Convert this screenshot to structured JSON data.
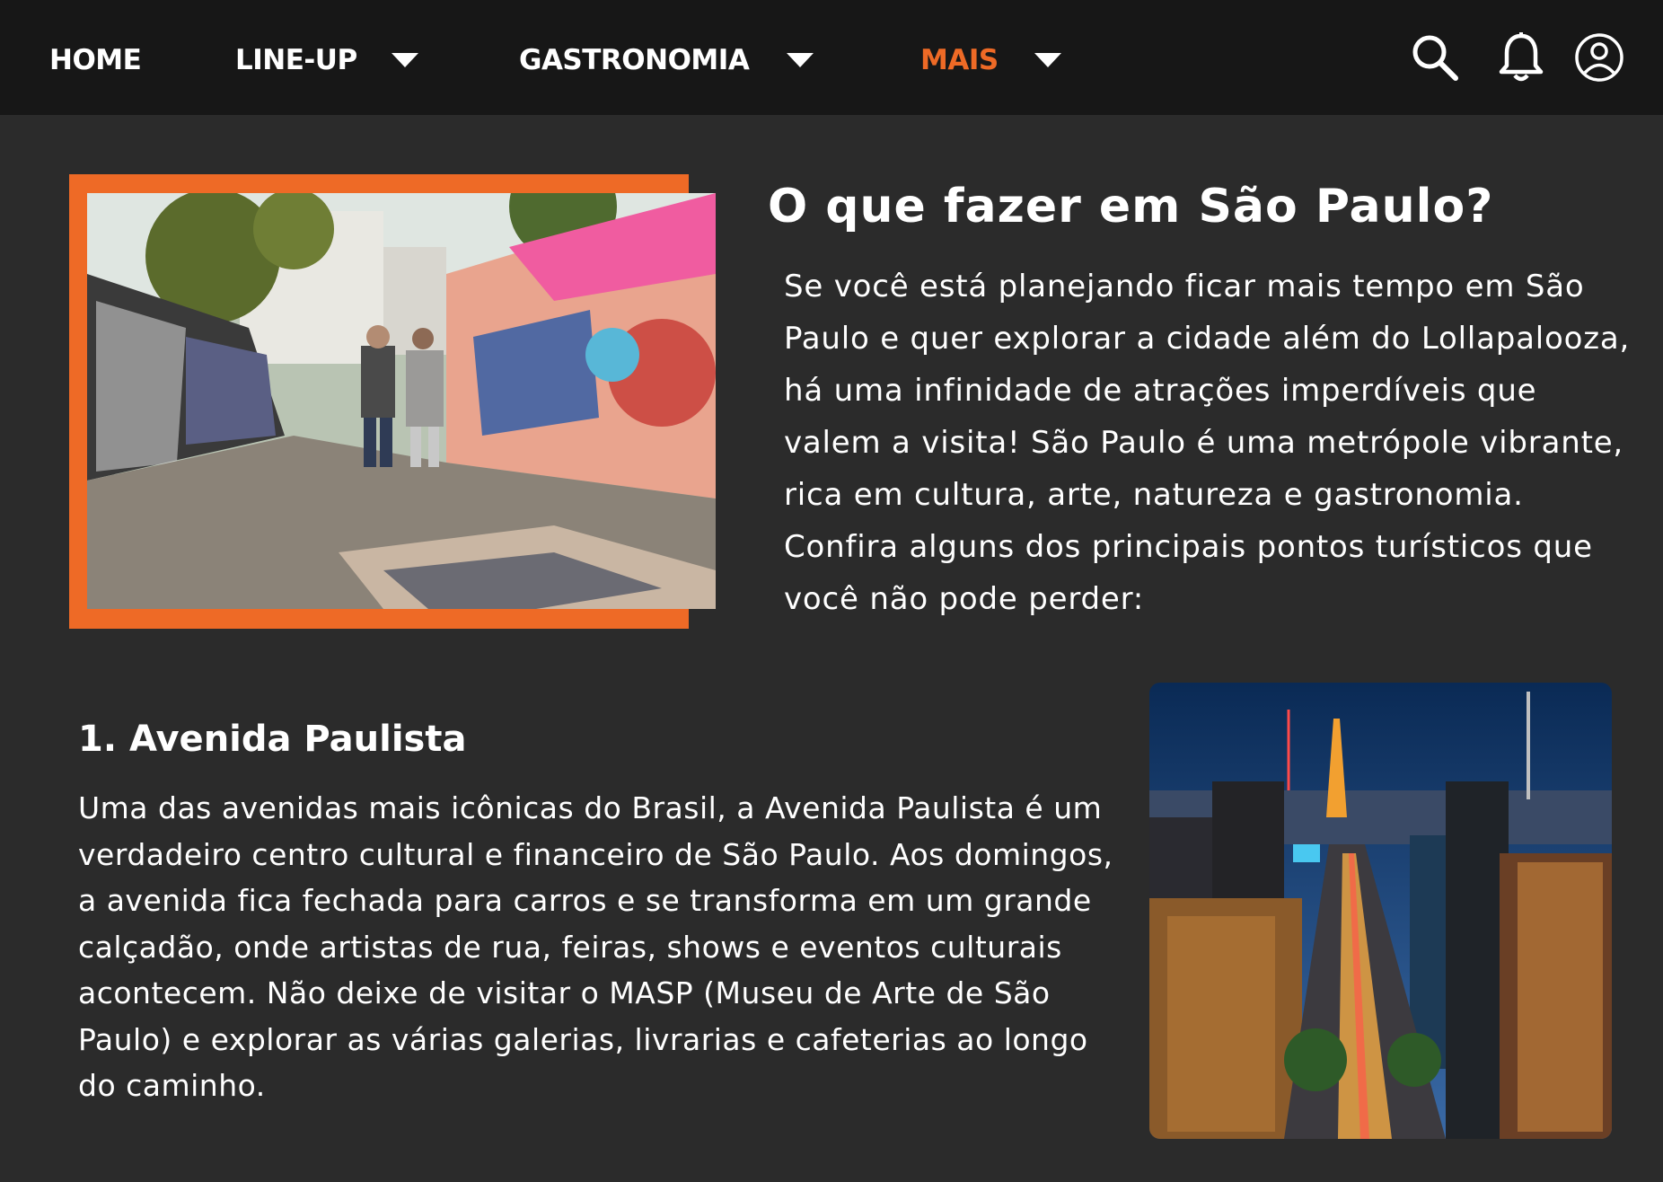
{
  "nav": {
    "items": [
      {
        "label": "HOME",
        "has_dropdown": false,
        "active": false
      },
      {
        "label": "LINE-UP",
        "has_dropdown": true,
        "active": false
      },
      {
        "label": "GASTRONOMIA",
        "has_dropdown": true,
        "active": false
      },
      {
        "label": "MAIS",
        "has_dropdown": true,
        "active": true
      }
    ],
    "icons": [
      "search-icon",
      "bell-icon",
      "user-icon"
    ]
  },
  "colors": {
    "background": "#2b2b2b",
    "nav_background": "#171717",
    "accent": "#ee6a26",
    "text": "#ffffff"
  },
  "intro": {
    "title": "O que fazer em São Paulo?",
    "text": "Se você está planejando ficar mais tempo em São Paulo e quer explorar a cidade além do Lollapalooza, há uma infinidade de atrações imperdíveis que valem a visita! São Paulo é uma metrópole vibrante, rica em cultura, arte, natureza e gastronomia. Confira alguns dos principais pontos turísticos que você não pode perder:"
  },
  "section1": {
    "title": "1. Avenida Paulista",
    "text": "Uma das avenidas mais icônicas do Brasil, a Avenida Paulista é um verdadeiro centro cultural e financeiro de São Paulo. Aos domingos, a avenida fica fechada para carros e se transforma em um grande calçadão, onde artistas de rua, feiras, shows e eventos culturais acontecem. Não deixe de visitar o MASP (Museu de Arte de São Paulo) e explorar as várias galerias, livrarias e cafeterias ao longo do caminho."
  }
}
